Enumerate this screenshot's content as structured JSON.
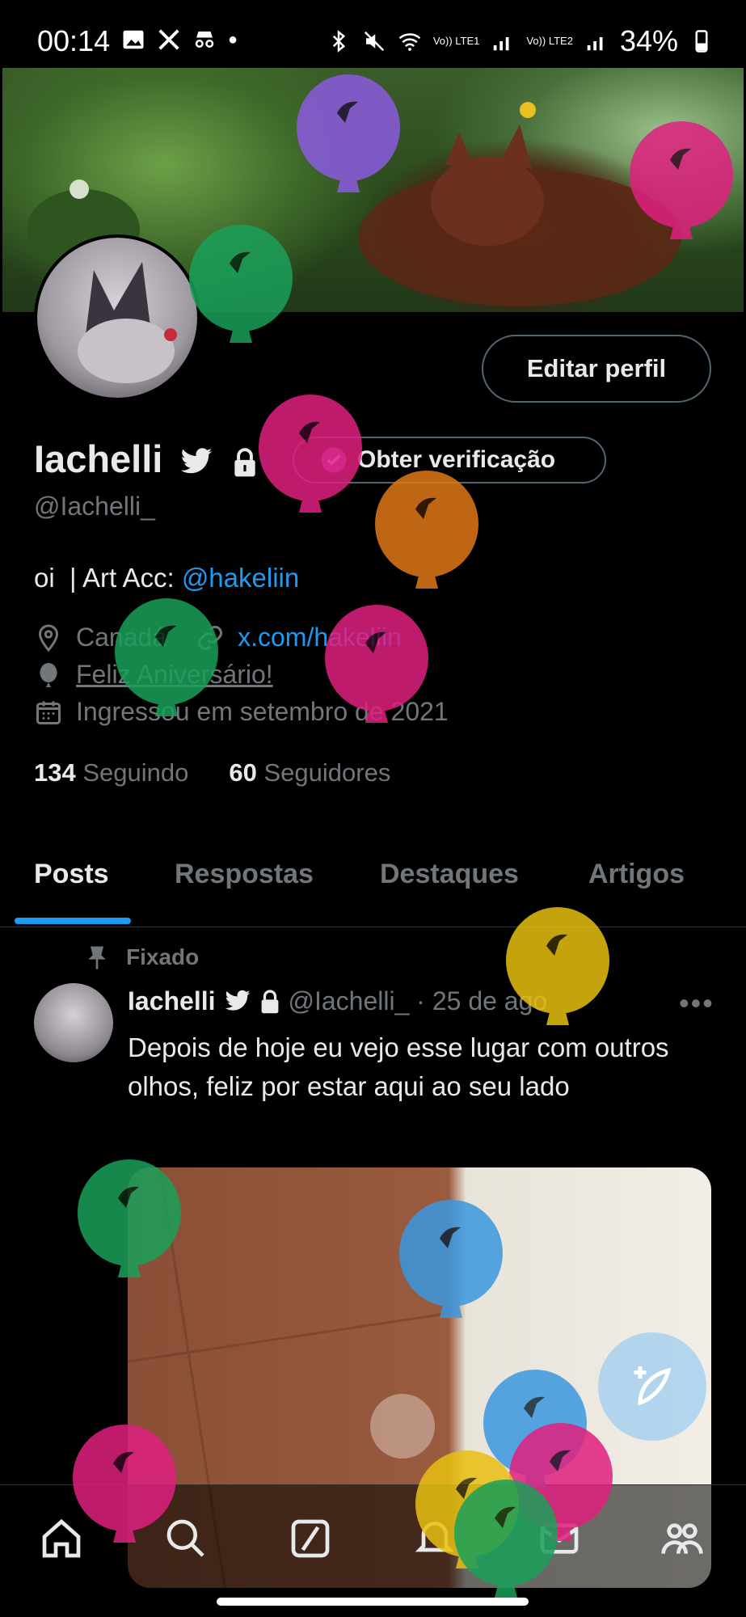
{
  "status_bar": {
    "time": "00:14",
    "battery": "34%",
    "net_lte1": "Vo)) LTE1",
    "net_lte2": "Vo)) LTE2"
  },
  "profile": {
    "edit_button": "Editar perfil",
    "name": "Iachelli",
    "verify_button": "Obter verificação",
    "handle": "@Iachelli_",
    "bio_text": "oi  | Art Acc: ",
    "bio_link": "@hakeliin",
    "location": "Canadá",
    "website": "x.com/hakeliin",
    "birthday": "Feliz Aniversário!",
    "joined": "Ingressou em setembro de 2021",
    "following_count": "134",
    "following_label": "Seguindo",
    "followers_count": "60",
    "followers_label": "Seguidores"
  },
  "tabs": [
    {
      "label": "Posts",
      "active": true
    },
    {
      "label": "Respostas",
      "active": false
    },
    {
      "label": "Destaques",
      "active": false
    },
    {
      "label": "Artigos",
      "active": false
    }
  ],
  "post": {
    "pinned_label": "Fixado",
    "author": "Iachelli",
    "handle_date": "@Iachelli_ · 25 de ago",
    "more": "•••",
    "text": "Depois de hoje eu vejo esse lugar com outros olhos, feliz por estar aqui ao seu lado"
  },
  "colors": {
    "accent": "#1d9bf0",
    "muted": "#71767b",
    "balloon_colors": [
      "#8c5ae0",
      "#e0207f",
      "#1aa05a",
      "#e07818",
      "#e8c010",
      "#3a98e0"
    ]
  },
  "icons": {
    "status_left": [
      "gallery-icon",
      "x-icon",
      "incognito-icon"
    ],
    "status_right": [
      "bluetooth-icon",
      "mute-icon",
      "wifi-icon",
      "signal-icon",
      "battery-icon"
    ],
    "nav": [
      "home-icon",
      "search-icon",
      "grok-icon",
      "notifications-icon",
      "messages-icon",
      "communities-icon"
    ]
  }
}
